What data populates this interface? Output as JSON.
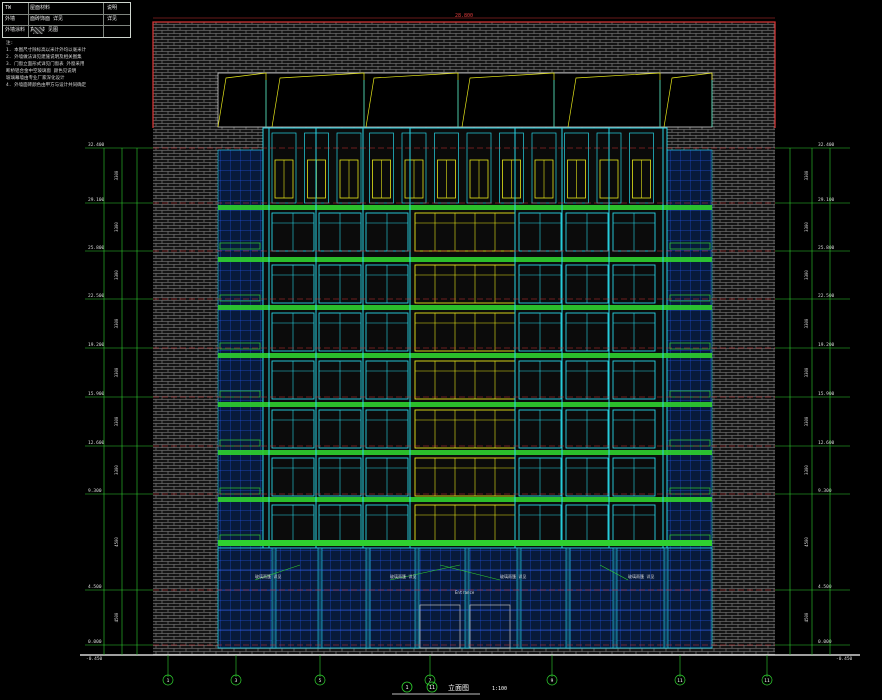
{
  "legend": {
    "rows": [
      {
        "code": "TW",
        "name": "屋面材料",
        "mark": "说明"
      },
      {
        "code": "外墙",
        "name": "面砖饰面 详见",
        "mark": "详见"
      },
      {
        "code": "外墙涂料",
        "name": "真石漆 见图",
        "mark": ""
      }
    ]
  },
  "notes": {
    "heading": "注:",
    "items": [
      "1. 本图尺寸除标高以米计外均以毫米计",
      "2. 外墙做法详见建施说明及相关图集",
      "3. 门窗立面形式详见门窗表 外窗采用",
      "   断桥铝合金中空玻璃窗 颜色见说明",
      "   玻璃幕墙由专业厂家深化设计",
      "4. 外墙面砖颜色由甲方与设计共同确定"
    ]
  },
  "drawing": {
    "title": "立面图",
    "scale": "1:100",
    "axis_left": "1",
    "axis_right": "11",
    "top_dim": "28.800",
    "axis_labels": [
      "1",
      "3",
      "5",
      "7",
      "9",
      "11"
    ],
    "canopy_notes": [
      "玻璃雨篷 详见",
      "玻璃雨篷 详见",
      "玻璃雨篷 详见",
      "玻璃雨篷 详见"
    ],
    "entrance_label": "Entrance",
    "levels": [
      {
        "elev": "32.400",
        "dim": "3300"
      },
      {
        "elev": "29.100",
        "dim": "3300"
      },
      {
        "elev": "25.800",
        "dim": "3300"
      },
      {
        "elev": "22.500",
        "dim": "3300"
      },
      {
        "elev": "19.200",
        "dim": "3300"
      },
      {
        "elev": "15.900",
        "dim": "3300"
      },
      {
        "elev": "12.600",
        "dim": "3300"
      },
      {
        "elev": "9.300",
        "dim": "4500"
      },
      {
        "elev": "4.500",
        "dim": "4500"
      },
      {
        "elev": "0.000",
        "dim": ""
      }
    ],
    "ground_left": "-0.450",
    "ground_right": "-0.450"
  },
  "colors": {
    "background": "#000000",
    "brick": "#9a9a9a",
    "parapet_red": "#d23434",
    "cyan": "#27d6e6",
    "green": "#2fd12f",
    "yellow": "#e6e61a",
    "blue": "#2b3cff",
    "white": "#ffffff"
  }
}
